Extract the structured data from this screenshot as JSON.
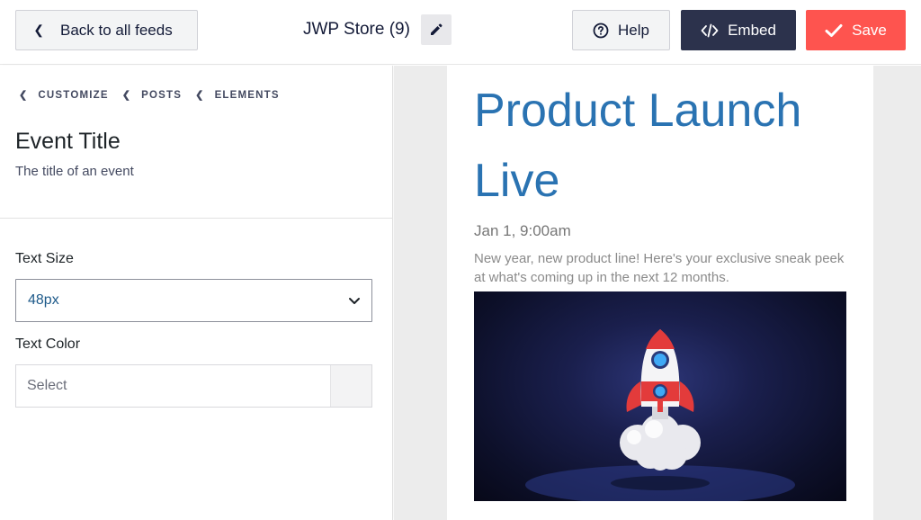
{
  "topbar": {
    "back_label": "Back to all feeds",
    "feed_title": "JWP Store (9)",
    "help_label": "Help",
    "embed_label": "Embed",
    "save_label": "Save"
  },
  "sidebar": {
    "breadcrumb": [
      "CUSTOMIZE",
      "POSTS",
      "ELEMENTS"
    ],
    "section_title": "Event Title",
    "section_description": "The title of an event",
    "text_size_label": "Text Size",
    "text_size_value": "48px",
    "text_color_label": "Text Color",
    "text_color_placeholder": "Select"
  },
  "preview": {
    "event_title": "Product Launch Live",
    "event_date": "Jan 1, 9:00am",
    "event_description": "New year, new product line! Here's your exclusive sneak peek at what's coming up in the next 12 months.",
    "title_color": "#2a73b2"
  },
  "colors": {
    "save": "#fe544f",
    "embed": "#2c324c",
    "link": "#1e5a8a"
  },
  "icons": {
    "back": "chevron-left-icon",
    "edit": "pencil-icon",
    "help": "question-circle-icon",
    "embed": "code-icon",
    "save": "checkmark-icon",
    "select": "chevron-down-icon"
  }
}
